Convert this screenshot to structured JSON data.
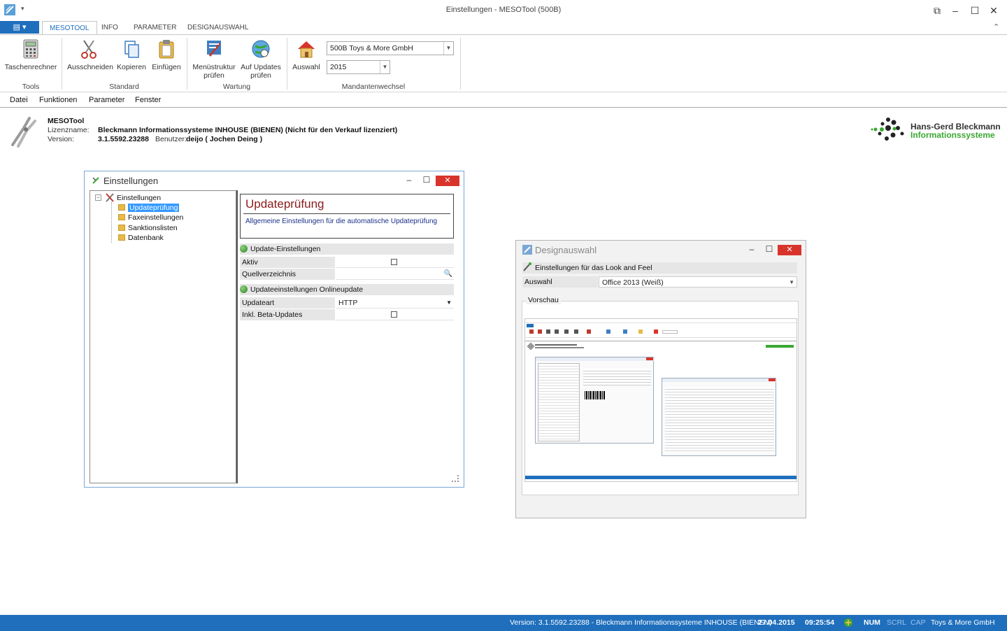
{
  "window": {
    "title": "Einstellungen - MESOTool (500B)",
    "controls": {
      "pin": "⧉",
      "minimize": "–",
      "maximize": "☐",
      "close": "✕"
    }
  },
  "ribbon_tabs": [
    {
      "label": "MESOTOOL",
      "active": true
    },
    {
      "label": "INFO"
    },
    {
      "label": "PARAMETER"
    },
    {
      "label": "DESIGNAUSWAHL"
    }
  ],
  "file_button": "▤ ▾",
  "ribbon": {
    "tools": {
      "group": "Tools",
      "taschenrechner": "Taschenrechner"
    },
    "standard": {
      "group": "Standard",
      "ausschneiden": "Ausschneiden",
      "kopieren": "Kopieren",
      "einfuegen": "Einfügen"
    },
    "wartung": {
      "group": "Wartung",
      "menuestruktur_1": "Menüstruktur",
      "menuestruktur_2": "prüfen",
      "updates_1": "Auf Updates",
      "updates_2": "prüfen"
    },
    "mandantenwechsel": {
      "group": "Mandantenwechsel",
      "auswahl": "Auswahl",
      "company": "500B Toys & More GmbH",
      "year": "2015"
    },
    "collapse": "⌃"
  },
  "menu": [
    {
      "label": "Datei"
    },
    {
      "label": "Funktionen"
    },
    {
      "label": "Parameter"
    },
    {
      "label": "Fenster"
    }
  ],
  "info": {
    "product": "MESOTool",
    "lizenz_label": "Lizenzname:",
    "lizenz_value": "Bleckmann Informationssysteme INHOUSE (BIENEN) (Nicht für den Verkauf lizenziert)",
    "version_label": "Version:",
    "version_value": "3.1.5592.23288",
    "benutzer_label": "Benutzer:",
    "benutzer_value": "deijo ( Jochen Deing )"
  },
  "logo": {
    "line1": "Hans-Gerd Bleckmann",
    "line2": "Informationssysteme"
  },
  "einstellungen": {
    "title": "Einstellungen",
    "tree": {
      "root": "Einstellungen",
      "children": [
        "Updateprüfung",
        "Faxeinstellungen",
        "Sanktionslisten",
        "Datenbank"
      ],
      "selected": "Updateprüfung"
    },
    "header_title": "Updateprüfung",
    "header_desc": "Allgemeine Einstellungen für die automatische Updateprüfung",
    "section1": "Update-Einstellungen",
    "aktiv": "Aktiv",
    "quellverzeichnis": "Quellverzeichnis",
    "section2": "Updateeinstellungen Onlineupdate",
    "updateart": "Updateart",
    "updateart_value": "HTTP",
    "beta": "Inkl. Beta-Updates"
  },
  "designauswahl": {
    "title": "Designauswahl",
    "section": "Einstellungen für das Look and Feel",
    "auswahl_label": "Auswahl",
    "auswahl_value": "Office 2013 (Weiß)",
    "vorschau": "Vorschau"
  },
  "statusbar": {
    "version": "Version: 3.1.5592.23288 - Bleckmann Informationssysteme INHOUSE (BIENEN)",
    "date": "27.04.2015",
    "time": "09:25:54",
    "num": "NUM",
    "scrl": "SCRL",
    "cap": "CAP",
    "company": "Toys & More GmbH"
  },
  "colors": {
    "accent": "#1f6fbd",
    "close": "#d9342b",
    "selection": "#3399ff",
    "logo_green": "#3aa832"
  }
}
